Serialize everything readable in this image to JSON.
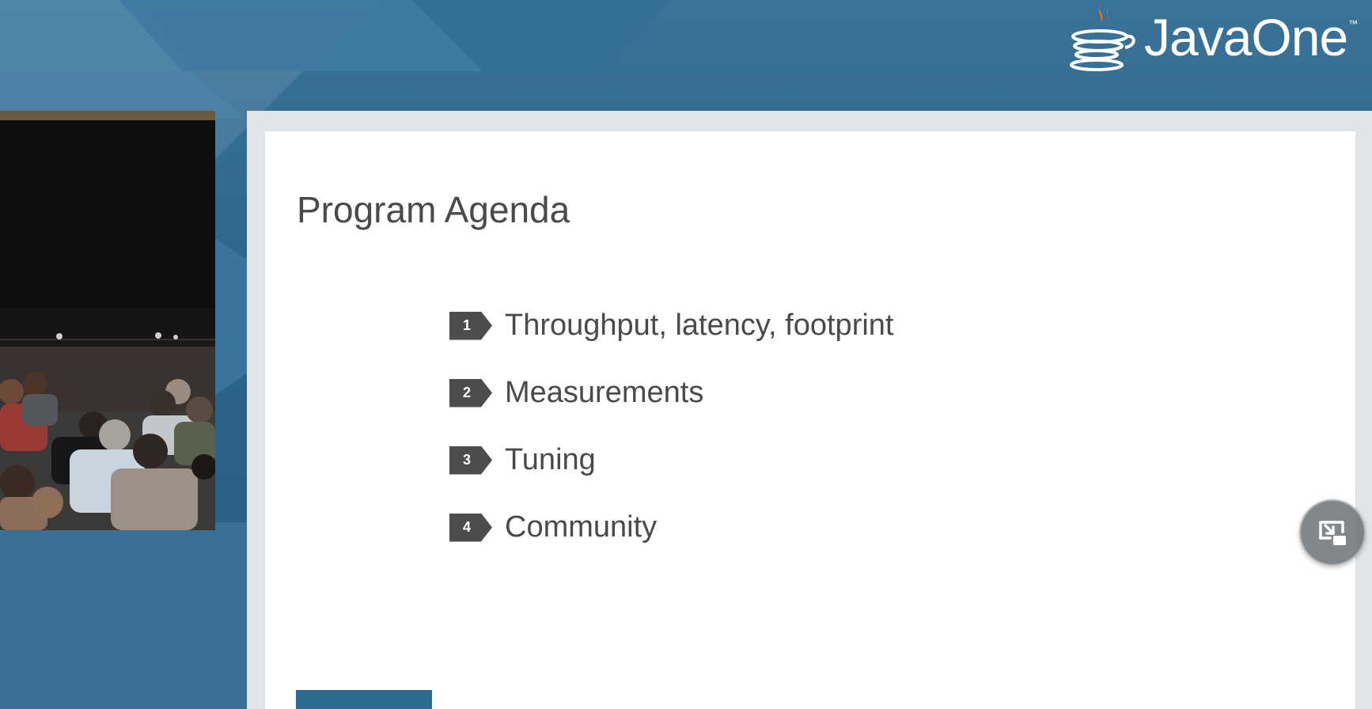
{
  "branding": {
    "logo_text": "JavaOne",
    "trademark": "™"
  },
  "slide": {
    "title": "Program Agenda",
    "items": [
      {
        "number": "1",
        "label": "Throughput, latency, footprint"
      },
      {
        "number": "2",
        "label": "Measurements"
      },
      {
        "number": "3",
        "label": "Tuning"
      },
      {
        "number": "4",
        "label": "Community"
      }
    ]
  },
  "controls": {
    "exit_pip_icon": "exit-picture-in-picture-icon"
  },
  "colors": {
    "background_blue": "#2a5d82",
    "badge_gray": "#4b4d4f",
    "java_orange": "#e87722",
    "text_gray": "#4a4a4a"
  }
}
